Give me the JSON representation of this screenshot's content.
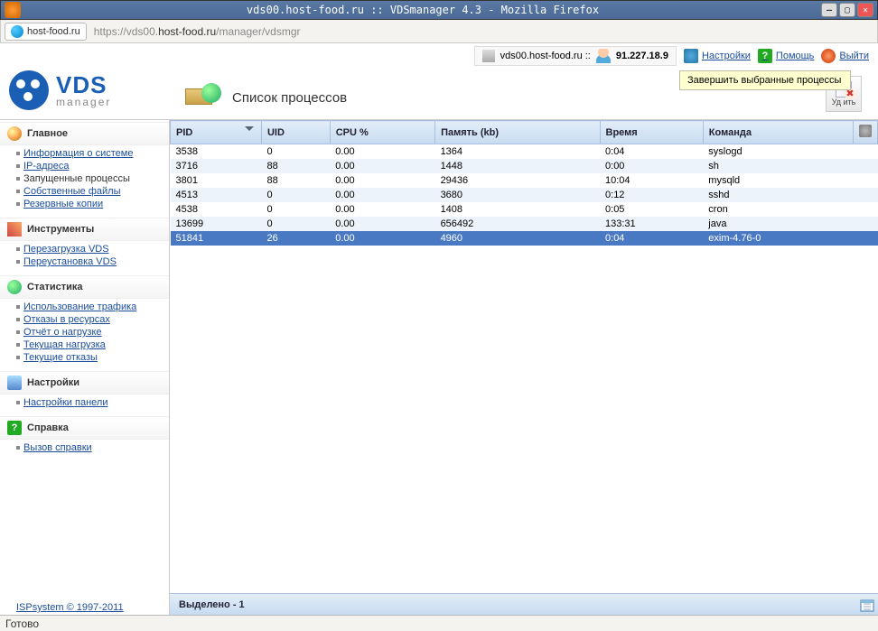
{
  "window": {
    "title": "vds00.host-food.ru :: VDSmanager 4.3 - Mozilla Firefox"
  },
  "browser": {
    "site_button": "host-food.ru",
    "url_prefix": "https://vds00.",
    "url_host": "host-food.ru",
    "url_suffix": "/manager/vdsmgr",
    "status": "Готово"
  },
  "header": {
    "server": "vds00.host-food.ru ::",
    "ip": "91.227.18.9",
    "links": {
      "settings": "Настройки",
      "help": "Помощь",
      "exit": "Выйти"
    }
  },
  "logo": {
    "t1": "VDS",
    "t2": "manager"
  },
  "page": {
    "title": "Список процессов"
  },
  "toolbar": {
    "delete_label": "Уд   ить"
  },
  "tooltip": "Завершить выбранные процессы",
  "sidebar": {
    "sections": [
      {
        "key": "main",
        "title": "Главное",
        "items": [
          "Информация о системе",
          "IP-адреса",
          "Запущенные процессы",
          "Собственные файлы",
          "Резервные копии"
        ],
        "active_index": 2
      },
      {
        "key": "tools",
        "title": "Инструменты",
        "items": [
          "Перезагрузка VDS",
          "Переустановка VDS"
        ]
      },
      {
        "key": "stats",
        "title": "Статистика",
        "items": [
          "Использование трафика",
          "Отказы в ресурсах",
          "Отчёт о нагрузке",
          "Текущая нагрузка",
          "Текущие отказы"
        ]
      },
      {
        "key": "cfg",
        "title": "Настройки",
        "items": [
          "Настройки панели"
        ]
      },
      {
        "key": "hlp",
        "title": "Справка",
        "items": [
          "Вызов справки"
        ]
      }
    ],
    "copyright": "ISPsystem © 1997-2011"
  },
  "table": {
    "columns": [
      "PID",
      "UID",
      "CPU %",
      "Память (kb)",
      "Время",
      "Команда"
    ],
    "sort_col": 0,
    "rows": [
      {
        "pid": "3538",
        "uid": "0",
        "cpu": "0.00",
        "mem": "1364",
        "time": "0:04",
        "cmd": "syslogd"
      },
      {
        "pid": "3716",
        "uid": "88",
        "cpu": "0.00",
        "mem": "1448",
        "time": "0:00",
        "cmd": "sh"
      },
      {
        "pid": "3801",
        "uid": "88",
        "cpu": "0.00",
        "mem": "29436",
        "time": "10:04",
        "cmd": "mysqld"
      },
      {
        "pid": "4513",
        "uid": "0",
        "cpu": "0.00",
        "mem": "3680",
        "time": "0:12",
        "cmd": "sshd"
      },
      {
        "pid": "4538",
        "uid": "0",
        "cpu": "0.00",
        "mem": "1408",
        "time": "0:05",
        "cmd": "cron"
      },
      {
        "pid": "13699",
        "uid": "0",
        "cpu": "0.00",
        "mem": "656492",
        "time": "133:31",
        "cmd": "java"
      },
      {
        "pid": "51841",
        "uid": "26",
        "cpu": "0.00",
        "mem": "4960",
        "time": "0:04",
        "cmd": "exim-4.76-0"
      }
    ],
    "selected_index": 6
  },
  "statusline": "Выделено - 1"
}
